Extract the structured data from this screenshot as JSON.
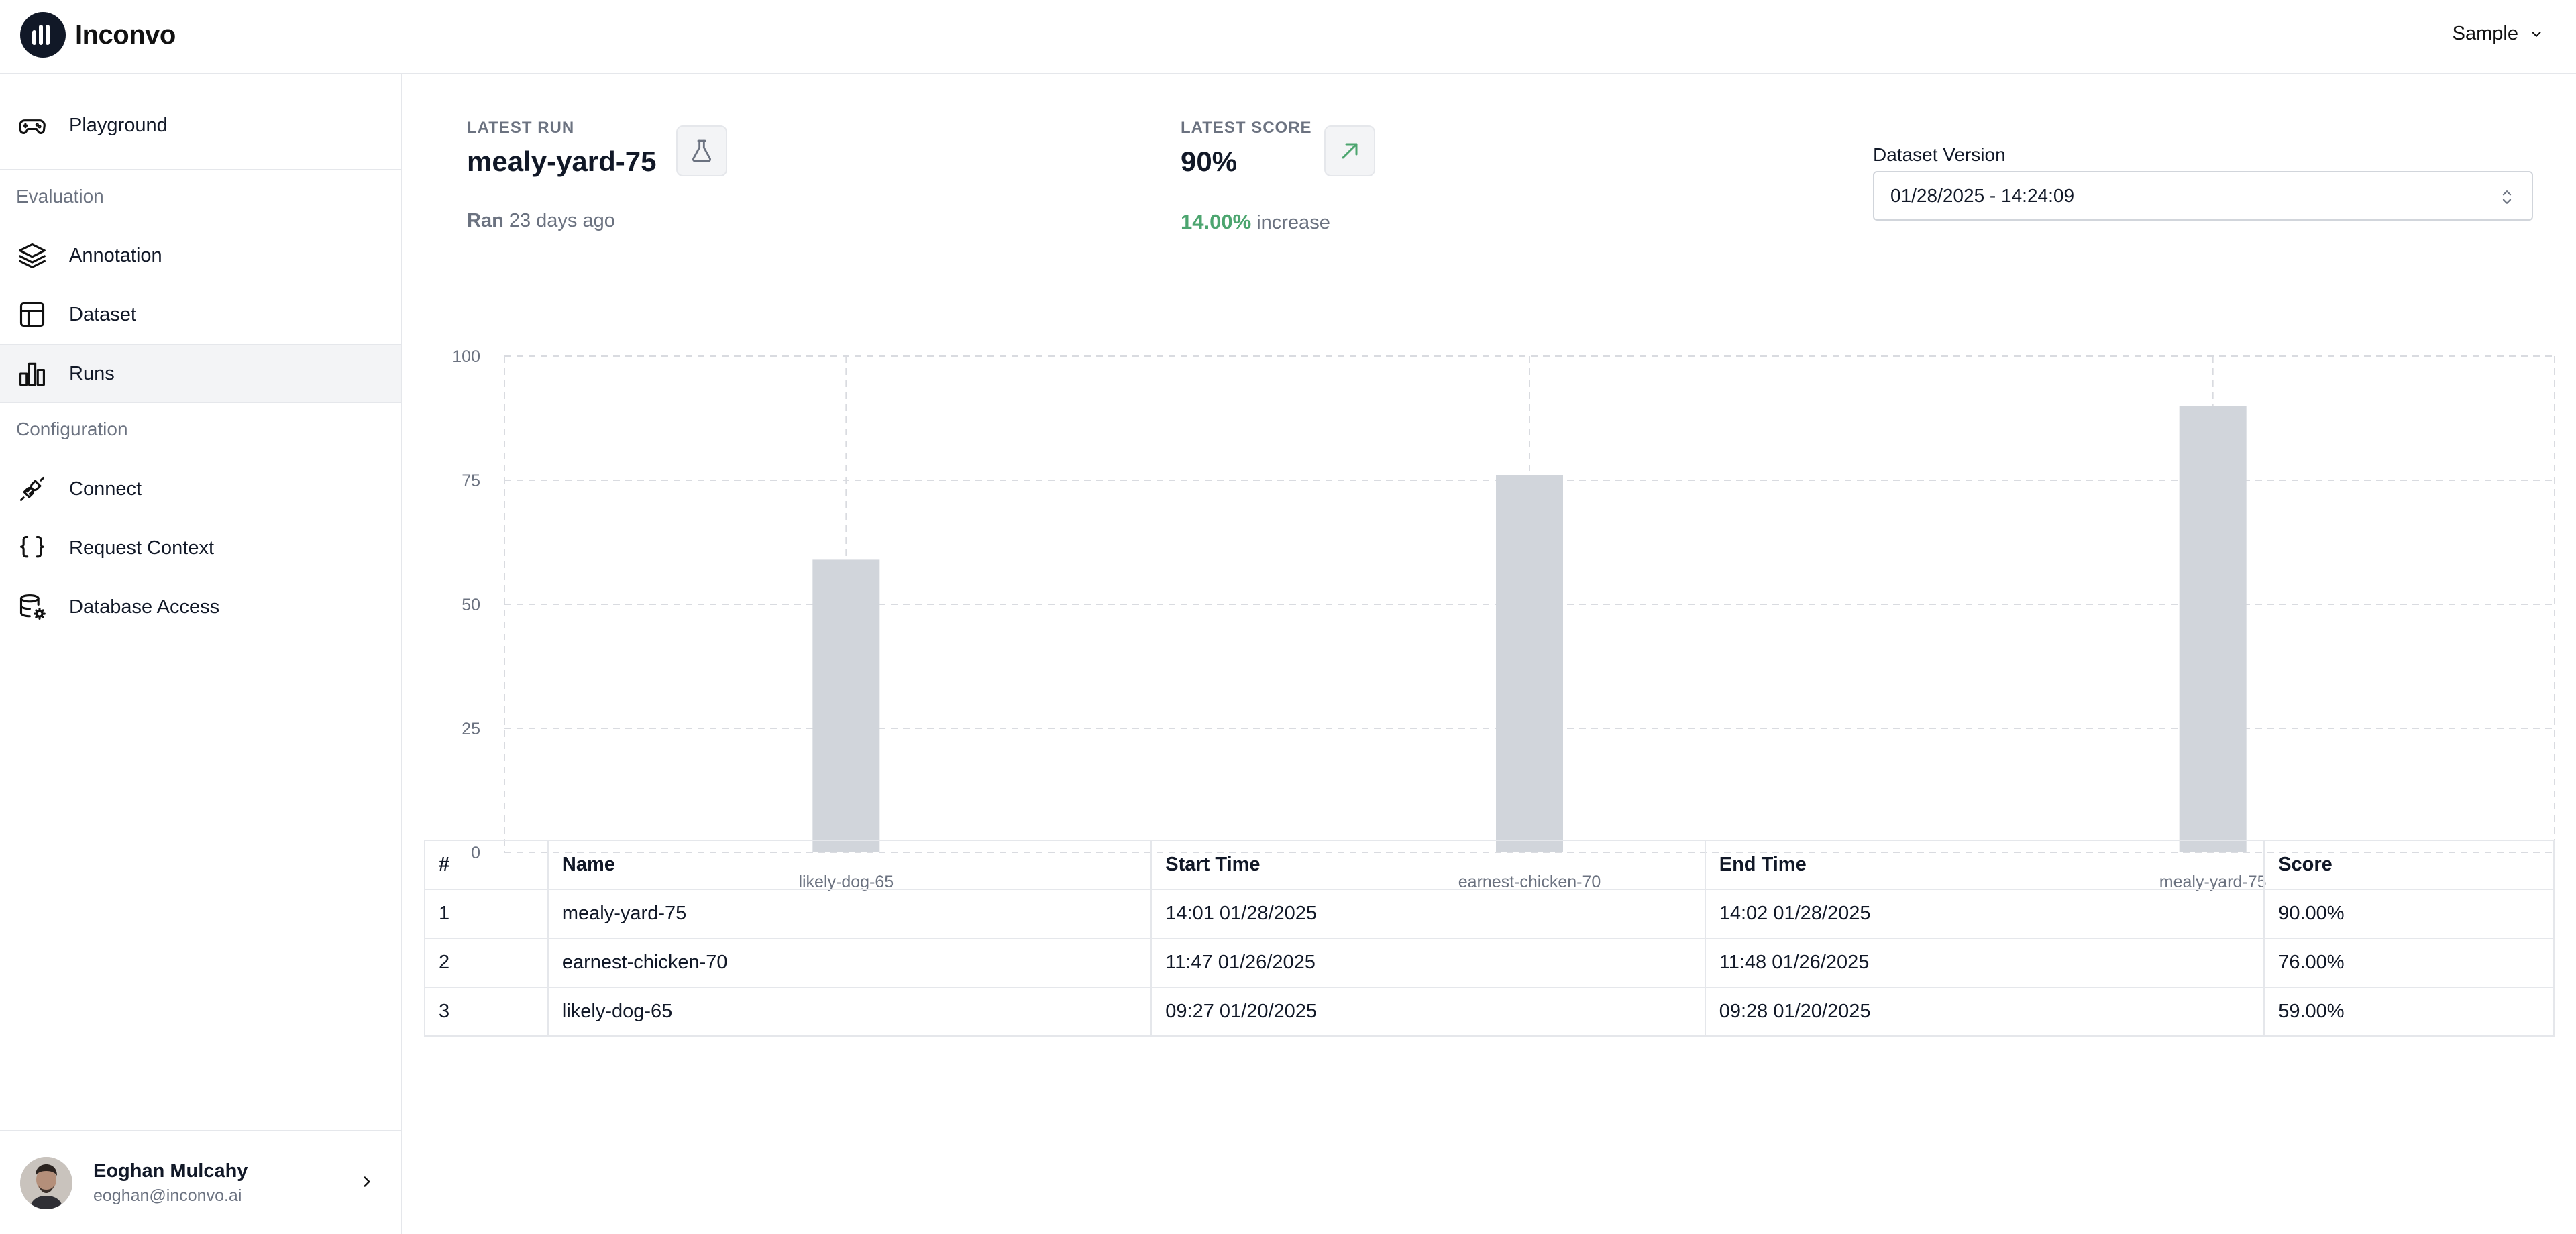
{
  "header": {
    "brand": "Inconvo",
    "workspace": "Sample"
  },
  "sidebar": {
    "playground": "Playground",
    "sections": {
      "evaluation": "Evaluation",
      "configuration": "Configuration"
    },
    "items": [
      {
        "label": "Annotation",
        "icon": "layers-icon"
      },
      {
        "label": "Dataset",
        "icon": "table-icon"
      },
      {
        "label": "Runs",
        "icon": "bar-chart-icon",
        "active": true
      },
      {
        "label": "Connect",
        "icon": "plug-icon"
      },
      {
        "label": "Request Context",
        "icon": "braces-icon"
      },
      {
        "label": "Database Access",
        "icon": "database-settings-icon"
      }
    ],
    "user": {
      "name": "Eoghan Mulcahy",
      "email": "eoghan@inconvo.ai"
    }
  },
  "stats": {
    "latest_run": {
      "label": "LATEST RUN",
      "value": "mealy-yard-75",
      "sub_prefix": "Ran",
      "sub_text": "23 days ago"
    },
    "latest_score": {
      "label": "LATEST SCORE",
      "value": "90%",
      "delta": "14.00%",
      "delta_text": "increase"
    }
  },
  "dataset_version": {
    "label": "Dataset Version",
    "value": "01/28/2025 - 14:24:09"
  },
  "chart_data": {
    "type": "bar",
    "categories": [
      "likely-dog-65",
      "earnest-chicken-70",
      "mealy-yard-75"
    ],
    "values": [
      59,
      76,
      90
    ],
    "ylim": [
      0,
      100
    ],
    "yticks": [
      0,
      25,
      50,
      75,
      100
    ],
    "grid": true,
    "bar_color": "#d1d5db"
  },
  "table": {
    "headers": [
      "#",
      "Name",
      "Start Time",
      "End Time",
      "Score"
    ],
    "rows": [
      [
        "1",
        "mealy-yard-75",
        "14:01 01/28/2025",
        "14:02 01/28/2025",
        "90.00%"
      ],
      [
        "2",
        "earnest-chicken-70",
        "11:47 01/26/2025",
        "11:48 01/26/2025",
        "76.00%"
      ],
      [
        "3",
        "likely-dog-65",
        "09:27 01/20/2025",
        "09:28 01/20/2025",
        "59.00%"
      ]
    ]
  }
}
